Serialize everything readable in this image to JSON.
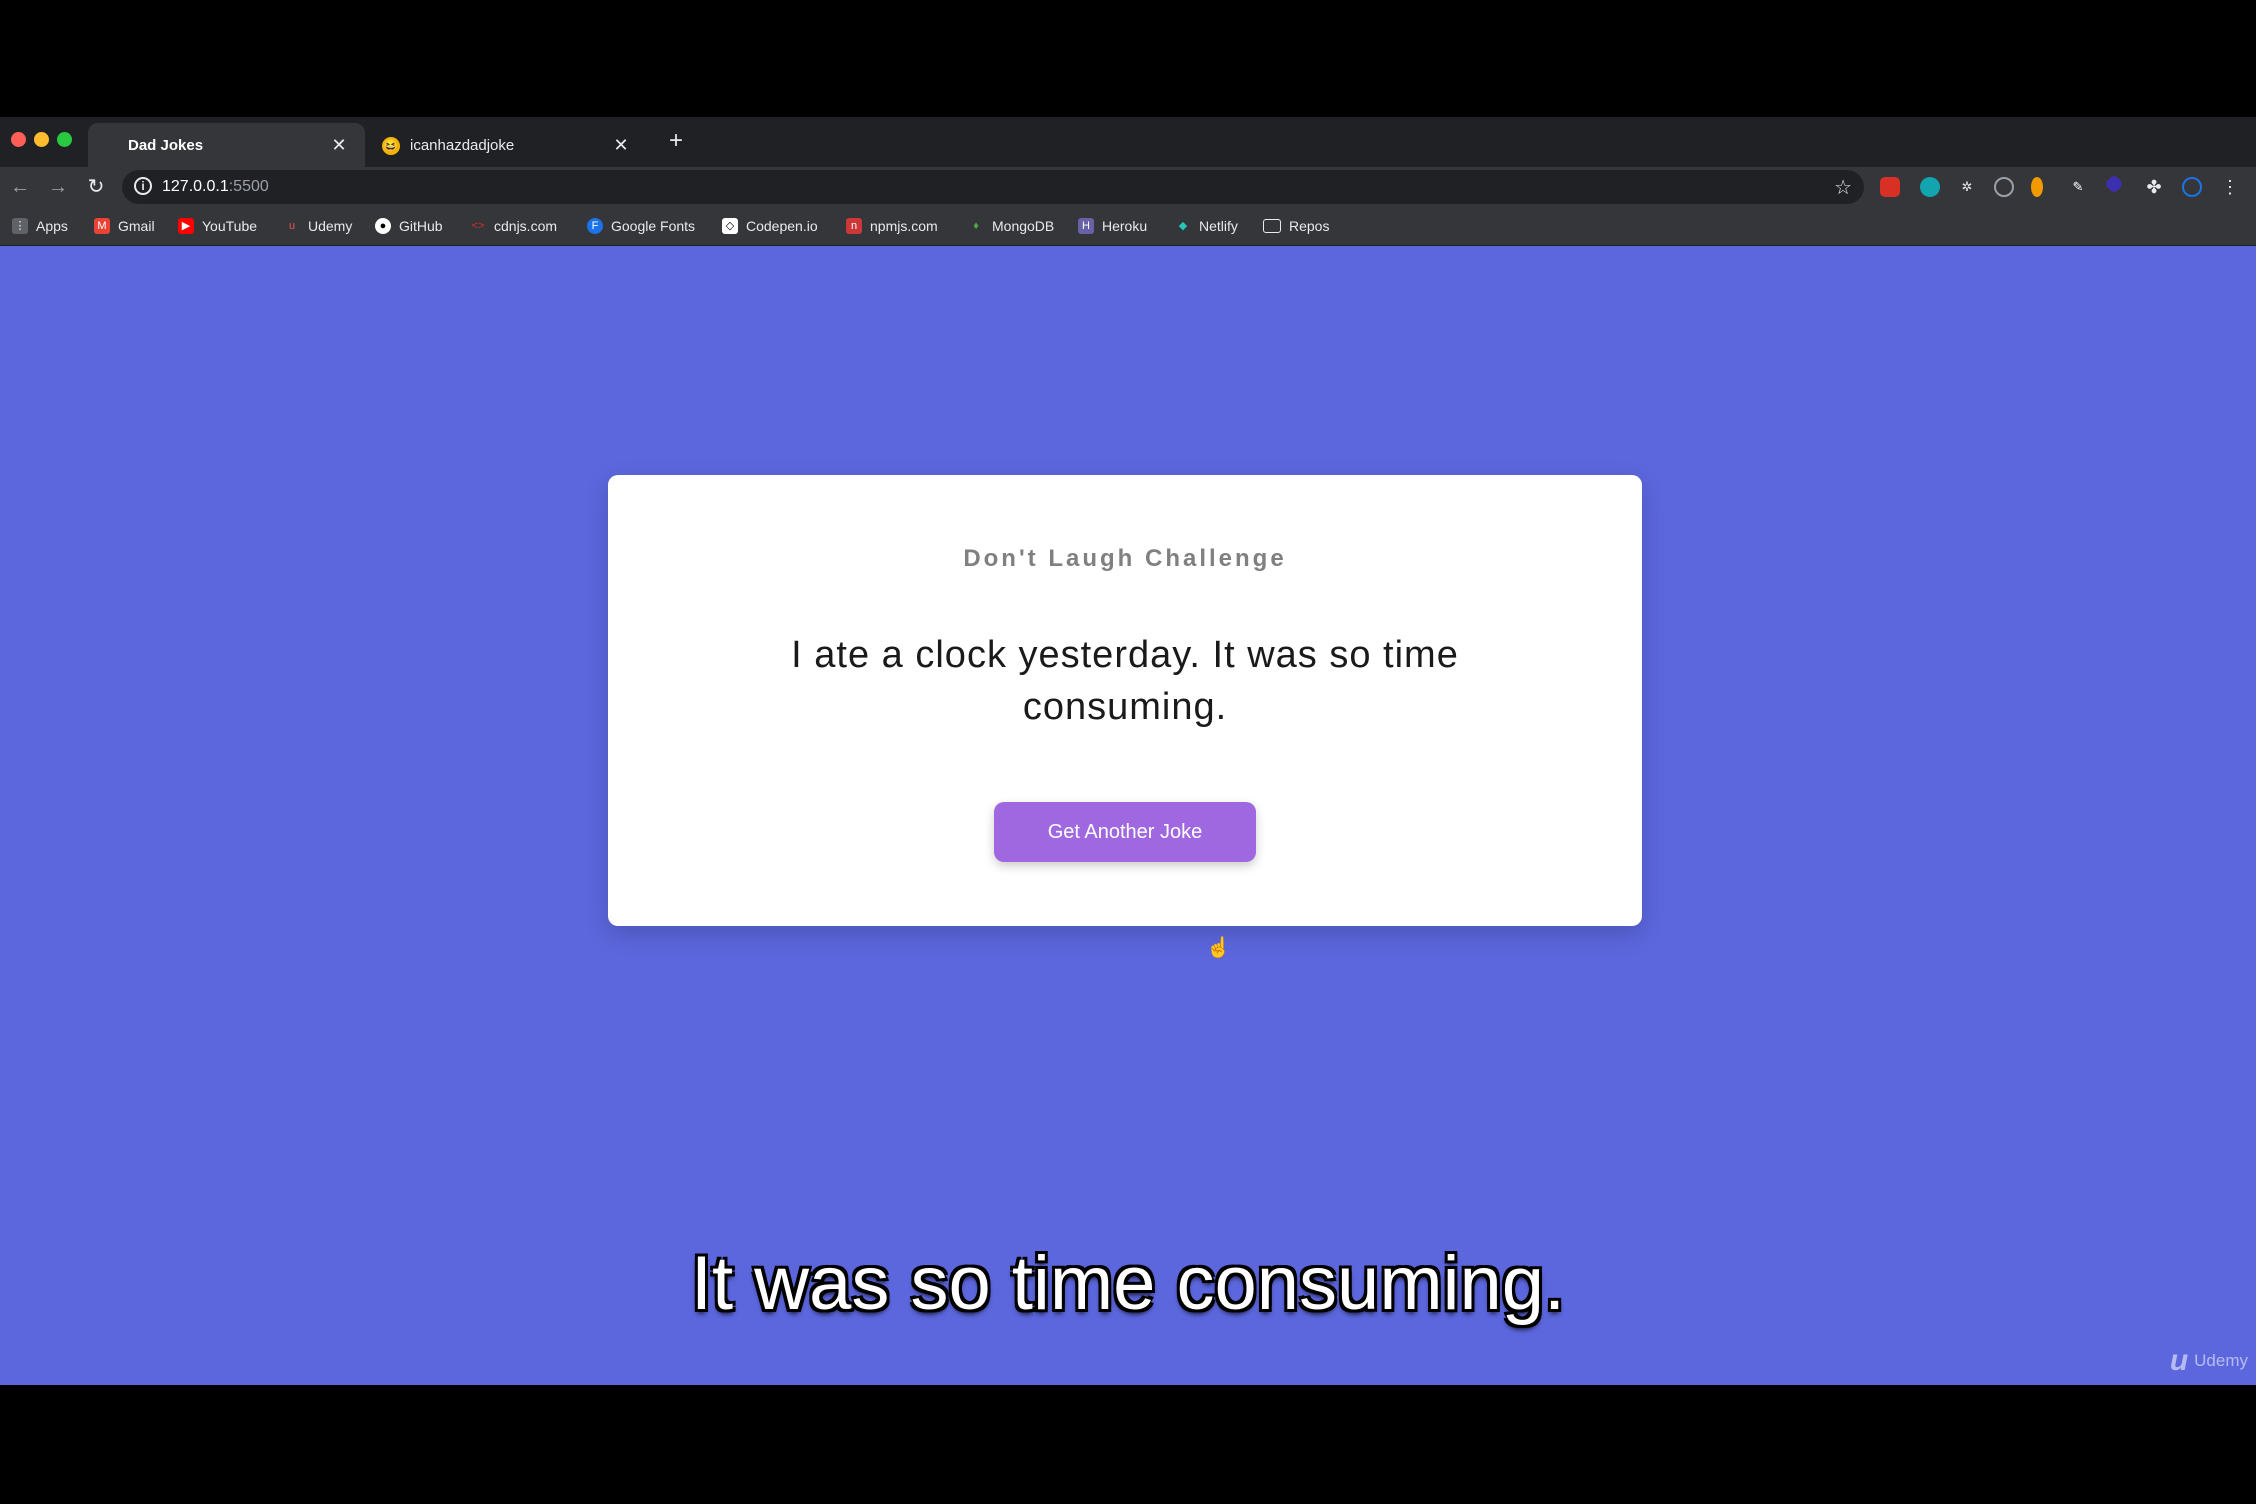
{
  "browser": {
    "tabs": [
      {
        "title": "Dad Jokes",
        "active": true
      },
      {
        "title": "icanhazdadjoke",
        "active": false
      }
    ],
    "new_tab_label": "+",
    "close_glyph": "✕",
    "url_host": "127.0.0.1",
    "url_port": ":5500",
    "bookmarks": [
      "Apps",
      "Gmail",
      "YouTube",
      "Udemy",
      "GitHub",
      "cdnjs.com",
      "Google Fonts",
      "Codepen.io",
      "npmjs.com",
      "MongoDB",
      "Heroku",
      "Netlify",
      "Repos"
    ]
  },
  "app": {
    "title": "Don't Laugh Challenge",
    "joke": "I ate a clock yesterday. It was so time consuming.",
    "button_label": "Get Another Joke"
  },
  "video": {
    "subtitle": "It was so time consuming.",
    "watermark": "Udemy"
  },
  "colors": {
    "page_background": "#5c67de",
    "button": "#9f68e0",
    "card": "#ffffff"
  }
}
